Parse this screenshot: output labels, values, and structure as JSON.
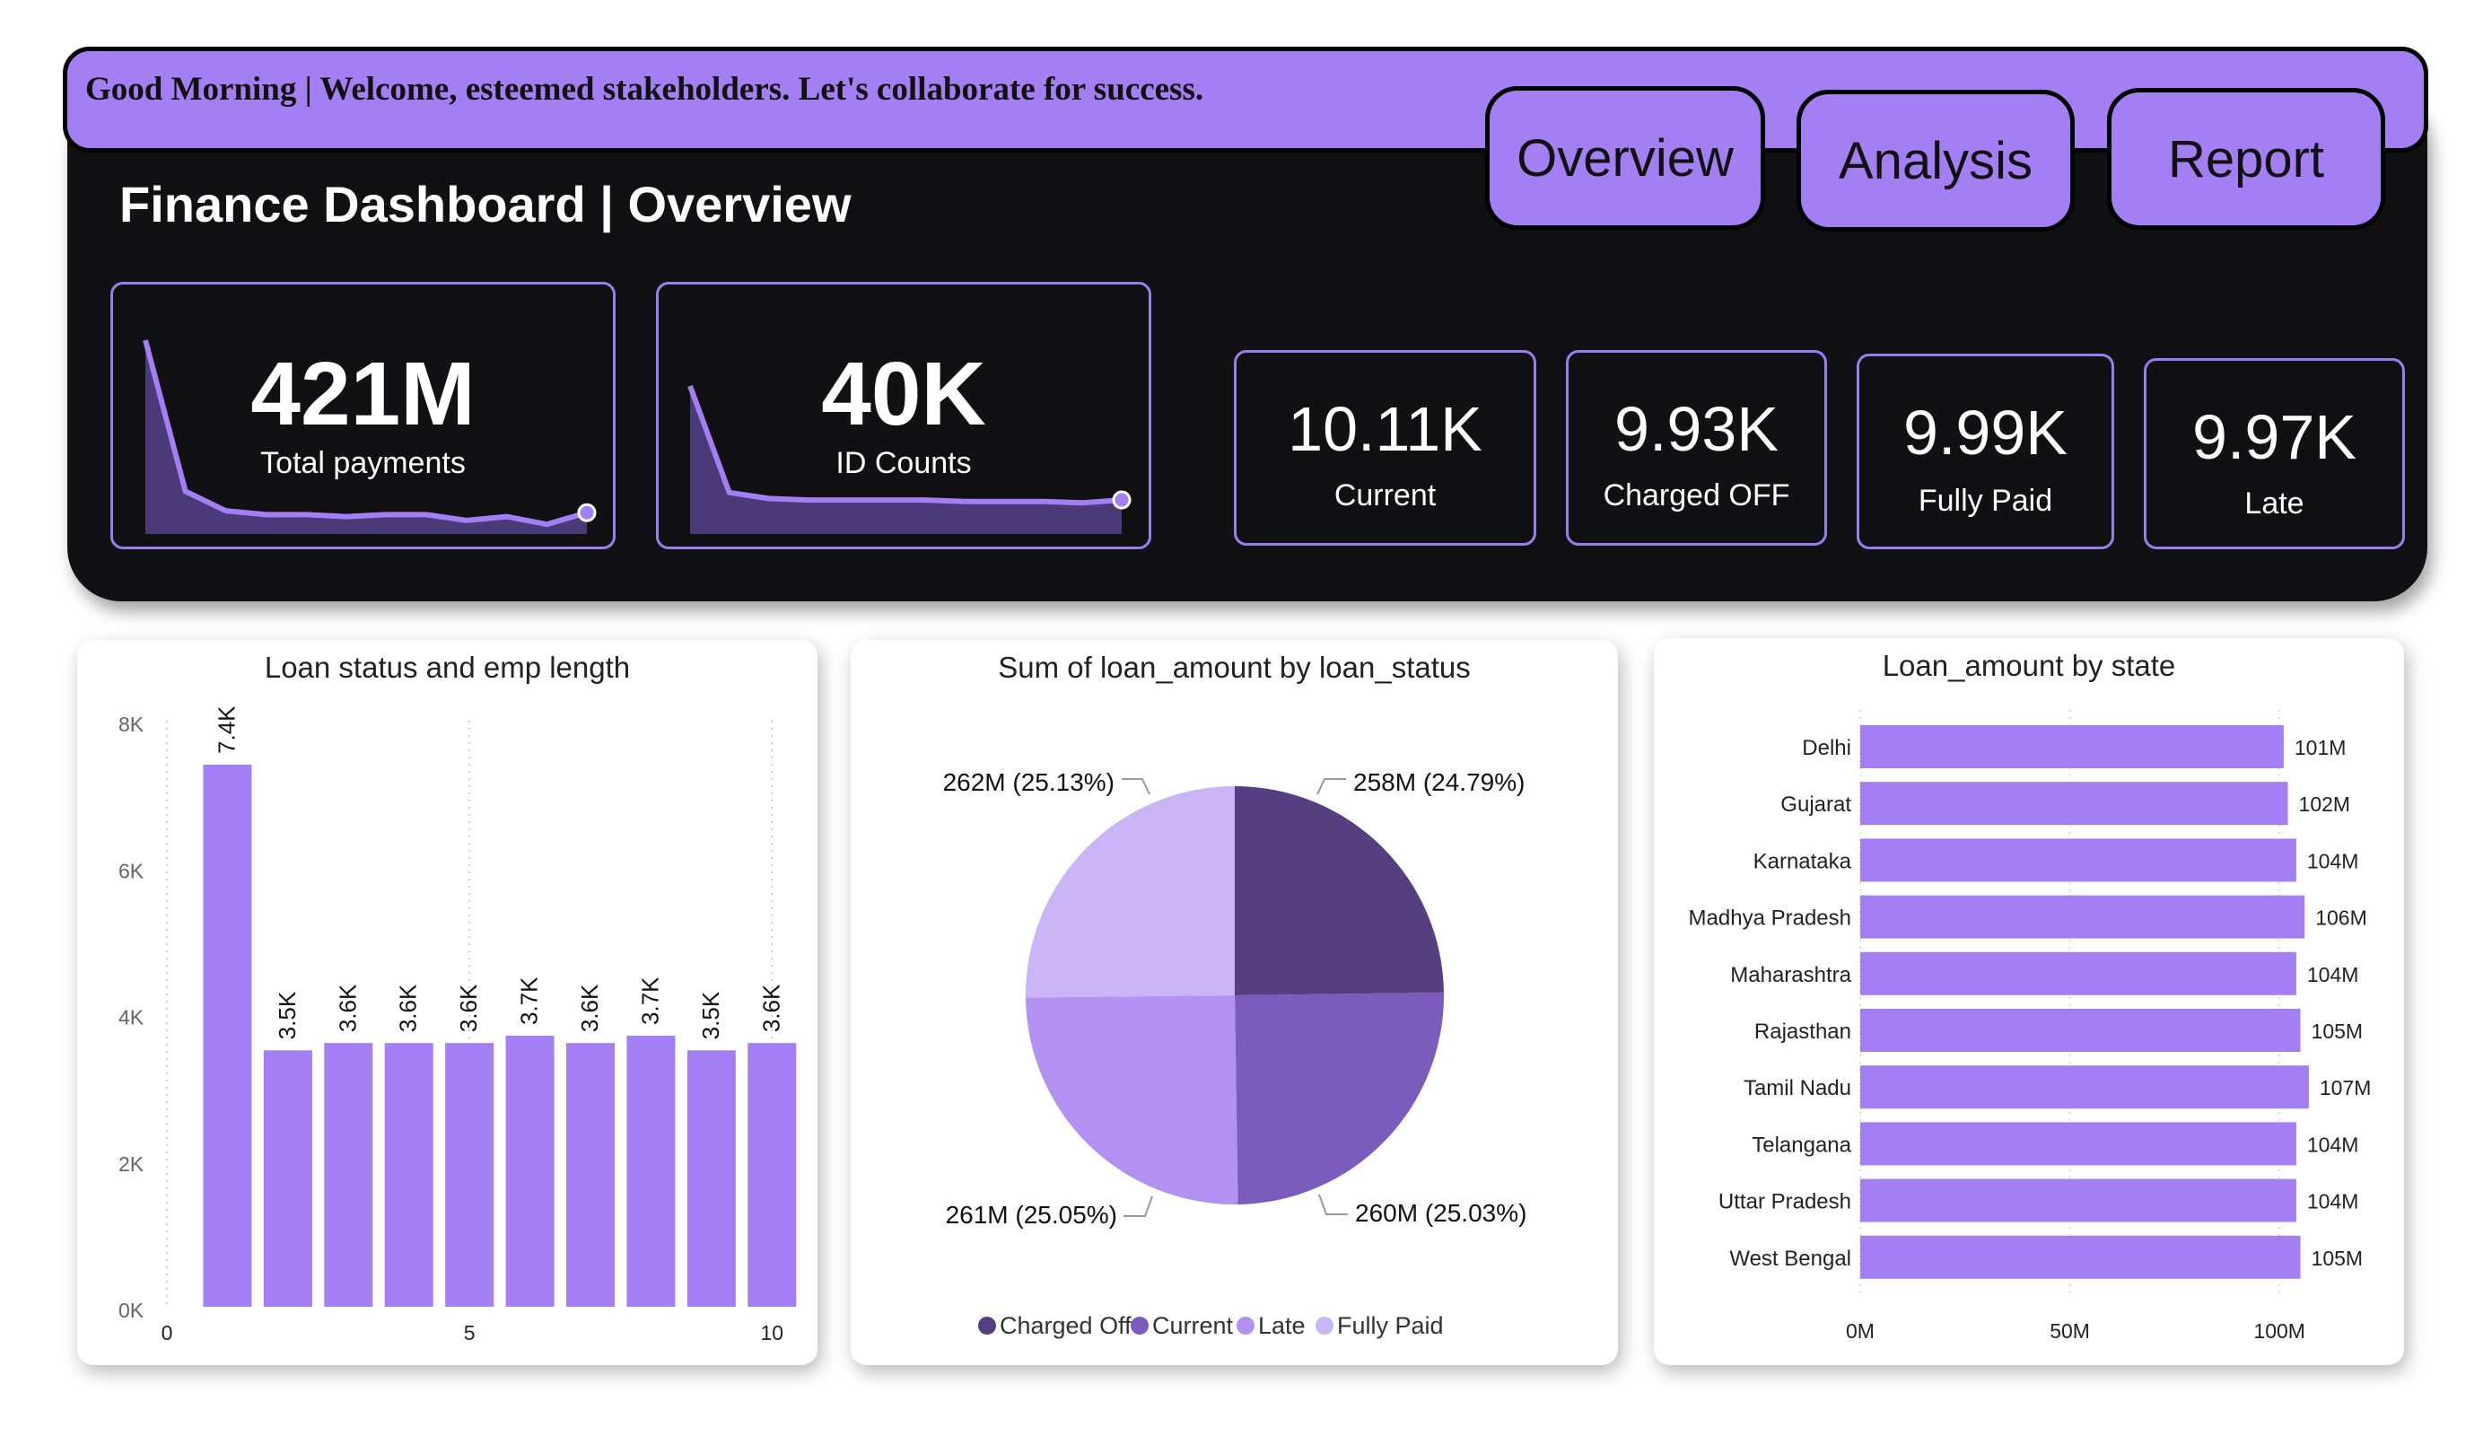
{
  "header": {
    "greeting": "Good Morning | Welcome, esteemed stakeholders. Let's collaborate for success.",
    "title": "Finance Dashboard | Overview",
    "nav": [
      {
        "label": "Overview"
      },
      {
        "label": "Analysis"
      },
      {
        "label": "Report"
      }
    ]
  },
  "kpis": {
    "total_payments": {
      "value": "421M",
      "label": "Total payments",
      "sparkline": [
        100,
        22,
        12,
        10,
        10,
        9,
        10,
        10,
        7,
        9,
        5,
        11
      ]
    },
    "id_counts": {
      "value": "40K",
      "label": "ID Counts",
      "sparkline": [
        100,
        28,
        24,
        23,
        23,
        23,
        23,
        22,
        22,
        22,
        21,
        23
      ]
    },
    "status_cards": [
      {
        "value": "10.11K",
        "label": "Current"
      },
      {
        "value": "9.93K",
        "label": "Charged OFF"
      },
      {
        "value": "9.99K",
        "label": "Fully Paid"
      },
      {
        "value": "9.97K",
        "label": "Late"
      }
    ]
  },
  "colors": {
    "accent": "#a47ef3",
    "header_bg": "#111013",
    "pie_charged_off": "#553f80",
    "pie_current": "#7b5cbd",
    "pie_late": "#b391f3",
    "pie_fully_paid": "#c9b4f6"
  },
  "chart_data": [
    {
      "type": "bar",
      "title": "Loan status and emp length",
      "x": [
        1,
        2,
        3,
        4,
        5,
        6,
        7,
        8,
        9,
        10
      ],
      "values": [
        7.4,
        3.5,
        3.6,
        3.6,
        3.6,
        3.7,
        3.6,
        3.7,
        3.5,
        3.6
      ],
      "data_labels": [
        "7.4K",
        "3.5K",
        "3.6K",
        "3.6K",
        "3.6K",
        "3.7K",
        "3.6K",
        "3.7K",
        "3.5K",
        "3.6K"
      ],
      "y_ticks": [
        "0K",
        "2K",
        "4K",
        "6K",
        "8K"
      ],
      "x_ticks": [
        "0",
        "5",
        "10"
      ],
      "ylim": [
        0,
        8
      ],
      "xlim": [
        0,
        10.5
      ]
    },
    {
      "type": "pie",
      "title": "Sum of loan_amount by loan_status",
      "slices": [
        {
          "name": "Charged Off",
          "value": 258,
          "label": "258M (24.79%)"
        },
        {
          "name": "Current",
          "value": 260,
          "label": "260M (25.03%)"
        },
        {
          "name": "Late",
          "value": 261,
          "label": "261M (25.05%)"
        },
        {
          "name": "Fully Paid",
          "value": 262,
          "label": "262M (25.13%)"
        }
      ]
    },
    {
      "type": "bar",
      "orientation": "horizontal",
      "title": "Loan_amount by state",
      "categories": [
        "Delhi",
        "Gujarat",
        "Karnataka",
        "Madhya Pradesh",
        "Maharashtra",
        "Rajasthan",
        "Tamil Nadu",
        "Telangana",
        "Uttar Pradesh",
        "West Bengal"
      ],
      "values": [
        101,
        102,
        104,
        106,
        104,
        105,
        107,
        104,
        104,
        105
      ],
      "data_labels": [
        "101M",
        "102M",
        "104M",
        "106M",
        "104M",
        "105M",
        "107M",
        "104M",
        "104M",
        "105M"
      ],
      "x_ticks": [
        "0M",
        "50M",
        "100M"
      ],
      "xlim": [
        0,
        125
      ]
    }
  ]
}
